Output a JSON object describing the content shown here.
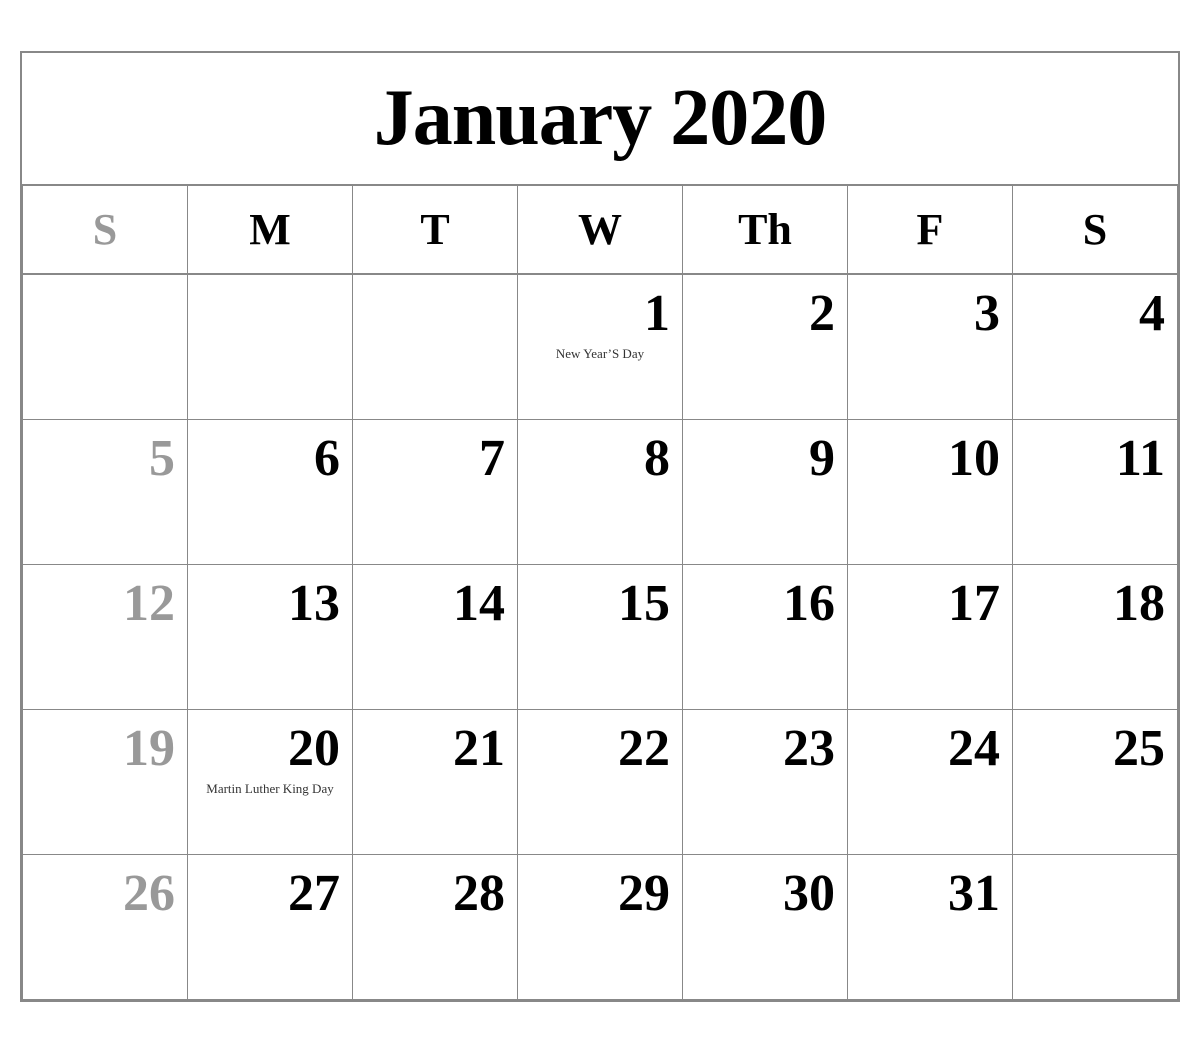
{
  "calendar": {
    "title": "January 2020",
    "headers": [
      {
        "label": "S",
        "isSunday": true
      },
      {
        "label": "M",
        "isSunday": false
      },
      {
        "label": "T",
        "isSunday": false
      },
      {
        "label": "W",
        "isSunday": false
      },
      {
        "label": "Th",
        "isSunday": false
      },
      {
        "label": "F",
        "isSunday": false
      },
      {
        "label": "S",
        "isSunday": false
      }
    ],
    "weeks": [
      {
        "days": [
          {
            "number": "",
            "empty": true
          },
          {
            "number": "",
            "empty": true
          },
          {
            "number": "",
            "empty": true
          },
          {
            "number": "1",
            "isSunday": false,
            "event": "New Year’S Day"
          },
          {
            "number": "2",
            "isSunday": false,
            "event": ""
          },
          {
            "number": "3",
            "isSunday": false,
            "event": ""
          },
          {
            "number": "4",
            "isSunday": false,
            "event": ""
          }
        ]
      },
      {
        "days": [
          {
            "number": "5",
            "isSunday": true,
            "event": ""
          },
          {
            "number": "6",
            "isSunday": false,
            "event": ""
          },
          {
            "number": "7",
            "isSunday": false,
            "event": ""
          },
          {
            "number": "8",
            "isSunday": false,
            "event": ""
          },
          {
            "number": "9",
            "isSunday": false,
            "event": ""
          },
          {
            "number": "10",
            "isSunday": false,
            "event": ""
          },
          {
            "number": "11",
            "isSunday": false,
            "event": ""
          }
        ]
      },
      {
        "days": [
          {
            "number": "12",
            "isSunday": true,
            "event": ""
          },
          {
            "number": "13",
            "isSunday": false,
            "event": ""
          },
          {
            "number": "14",
            "isSunday": false,
            "event": ""
          },
          {
            "number": "15",
            "isSunday": false,
            "event": ""
          },
          {
            "number": "16",
            "isSunday": false,
            "event": ""
          },
          {
            "number": "17",
            "isSunday": false,
            "event": ""
          },
          {
            "number": "18",
            "isSunday": false,
            "event": ""
          }
        ]
      },
      {
        "days": [
          {
            "number": "19",
            "isSunday": true,
            "event": ""
          },
          {
            "number": "20",
            "isSunday": false,
            "event": "Martin Luther King Day"
          },
          {
            "number": "21",
            "isSunday": false,
            "event": ""
          },
          {
            "number": "22",
            "isSunday": false,
            "event": ""
          },
          {
            "number": "23",
            "isSunday": false,
            "event": ""
          },
          {
            "number": "24",
            "isSunday": false,
            "event": ""
          },
          {
            "number": "25",
            "isSunday": false,
            "event": ""
          }
        ]
      },
      {
        "days": [
          {
            "number": "26",
            "isSunday": true,
            "event": ""
          },
          {
            "number": "27",
            "isSunday": false,
            "event": ""
          },
          {
            "number": "28",
            "isSunday": false,
            "event": ""
          },
          {
            "number": "29",
            "isSunday": false,
            "event": ""
          },
          {
            "number": "30",
            "isSunday": false,
            "event": ""
          },
          {
            "number": "31",
            "isSunday": false,
            "event": ""
          },
          {
            "number": "",
            "empty": true
          }
        ]
      }
    ]
  }
}
